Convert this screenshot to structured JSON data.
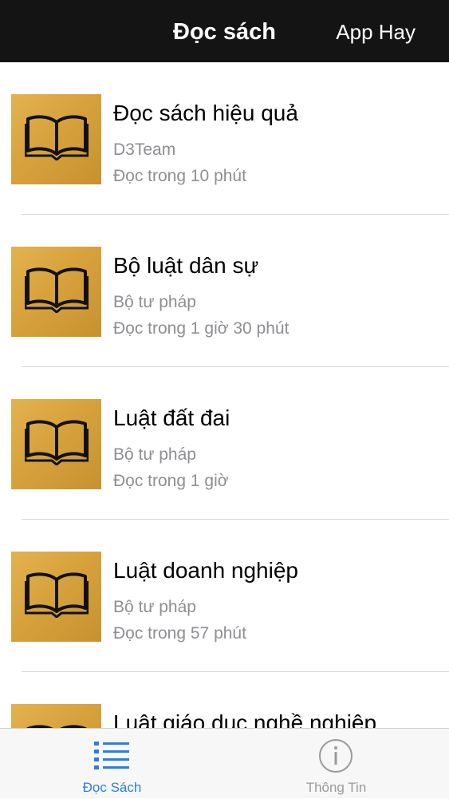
{
  "navbar": {
    "title": "Đọc sách",
    "right_button": "App Hay"
  },
  "books": [
    {
      "title": "Đọc sách hiệu quả",
      "author": "D3Team",
      "time": "Đọc trong 10 phút"
    },
    {
      "title": "Bộ luật dân sự",
      "author": "Bộ tư pháp",
      "time": "Đọc trong 1 giờ 30 phút"
    },
    {
      "title": "Luật đất đai",
      "author": "Bộ tư pháp",
      "time": "Đọc trong 1 giờ"
    },
    {
      "title": "Luật doanh nghiệp",
      "author": "Bộ tư pháp",
      "time": "Đọc trong 57 phút"
    },
    {
      "title": "Luật giáo dục nghề nghiệp",
      "author": "",
      "time": ""
    }
  ],
  "tabbar": {
    "tabs": [
      {
        "label": "Đọc Sách",
        "icon": "list-icon",
        "active": true
      },
      {
        "label": "Thông Tin",
        "icon": "info-icon",
        "active": false
      }
    ]
  },
  "colors": {
    "navbar_bg": "#141414",
    "cover_gold": "#d7a23c",
    "active_tab": "#2a7fe0",
    "inactive_tab": "#9a9a9e",
    "subtitle_gray": "#8e8e93"
  }
}
